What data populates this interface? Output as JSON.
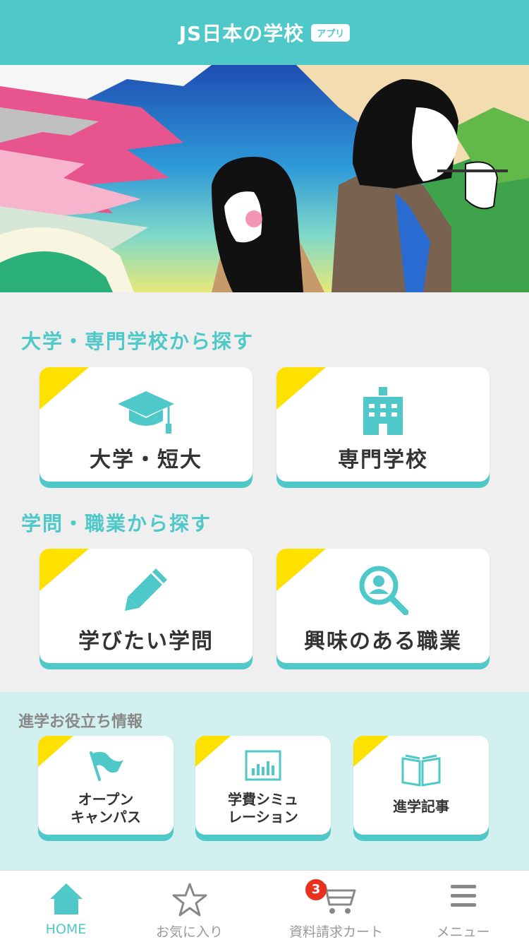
{
  "header": {
    "title": "JS日本の学校",
    "badge": "アプリ"
  },
  "sections": {
    "school_search": "大学・専門学校から探す",
    "field_search": "学問・職業から探す",
    "info": "進学お役立ち情報"
  },
  "cards": {
    "university": "大学・短大",
    "vocational": "専門学校",
    "study": "学びたい学問",
    "career": "興味のある職業"
  },
  "info_cards": {
    "open_campus_1": "オープン",
    "open_campus_2": "キャンパス",
    "cost_sim_1": "学費シミュ",
    "cost_sim_2": "レーション",
    "articles": "進学記事"
  },
  "tabbar": {
    "home": "HOME",
    "favorites": "お気に入り",
    "cart": "資料請求カート",
    "cart_count": "3",
    "menu": "メニュー"
  },
  "colors": {
    "accent": "#4ec8c8",
    "corner": "#ffe100",
    "badge": "#e8321e"
  }
}
